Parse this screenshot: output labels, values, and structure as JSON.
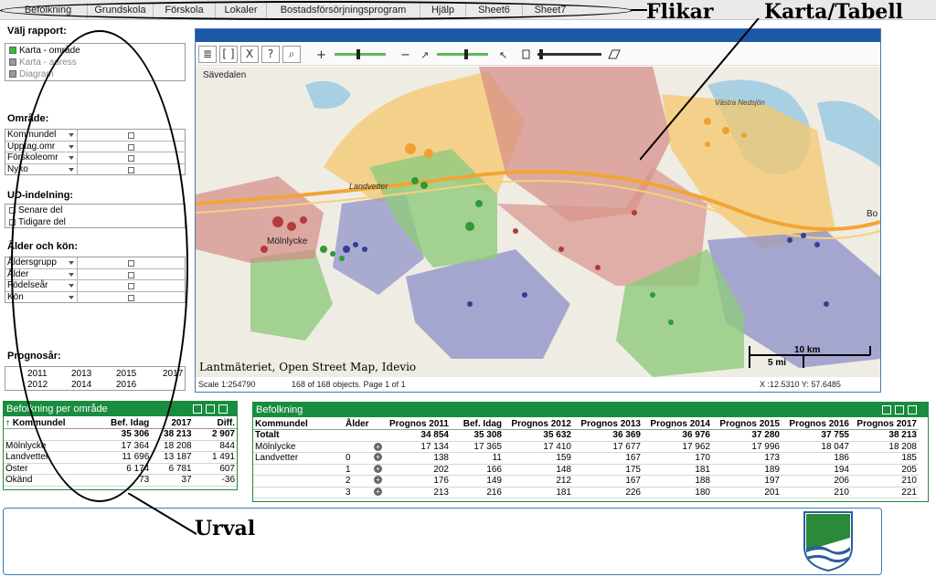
{
  "tabs": [
    "Befolkning",
    "Grundskola",
    "Förskola",
    "Lokaler",
    "Bostadsförsörjningsprogram",
    "Hjälp",
    "Sheet6",
    "Sheet7"
  ],
  "annotations": {
    "tabs": "Flikar",
    "map": "Karta/Tabell",
    "selection": "Urval"
  },
  "left": {
    "report_title": "Välj rapport:",
    "reports": [
      {
        "label": "Karta - område",
        "color": "#2ec52e"
      },
      {
        "label": "Karta - adress",
        "color": "#9a9a9a"
      },
      {
        "label": "Diagram",
        "color": "#9a9a9a"
      }
    ],
    "area_title": "Område:",
    "area_fields": [
      "Kommundel",
      "Upptag.omr",
      "Förskoleomr",
      "Nyko"
    ],
    "ud_title": "UD-indelning:",
    "ud_options": [
      "Senare del",
      "Tidigare del"
    ],
    "age_title": "Ålder och kön:",
    "age_fields": [
      "Åldersgrupp",
      "Ålder",
      "Födelseår",
      "Kön"
    ],
    "year_title": "Prognosår:",
    "years_row1": [
      "2011",
      "2013",
      "2015",
      "2017"
    ],
    "years_row2": [
      "2012",
      "2014",
      "2016"
    ]
  },
  "map": {
    "tool_buttons": [
      "≣",
      "[ ]",
      "X",
      "?",
      "⌕"
    ],
    "place_labels": [
      "Sävedalen",
      "Landvetter",
      "Mölnlycke",
      "Västra Nedsjön",
      "Bo"
    ],
    "scale_km": "10 km",
    "scale_mi": "5 mi",
    "attribution": "Lantmäteriet, Open Street Map, Idevio",
    "status_scale": "Scale 1:254790",
    "status_objects": "168 of 168 objects. Page 1 of 1",
    "status_coords": "X :12.5310 Y: 57.6485"
  },
  "table_left": {
    "title": "Befolkning per område",
    "columns": [
      "↑ Kommundel",
      "Bef. Idag",
      "2017",
      "Diff."
    ],
    "totals": [
      "",
      "35 306",
      "38 213",
      "2 907"
    ],
    "rows": [
      [
        "Mölnlycke",
        "17 364",
        "18 208",
        "844"
      ],
      [
        "Landvetter",
        "11 696",
        "13 187",
        "1 491"
      ],
      [
        "Öster",
        "6 174",
        "6 781",
        "607"
      ],
      [
        "Okänd",
        "73",
        "37",
        "-36"
      ]
    ]
  },
  "table_right": {
    "title": "Befolkning",
    "columns": [
      "Kommundel",
      "Ålder",
      "Prognos 2011",
      "Bef. Idag",
      "Prognos 2012",
      "Prognos 2013",
      "Prognos 2014",
      "Prognos 2015",
      "Prognos 2016",
      "Prognos 2017"
    ],
    "total_label": "Totalt",
    "totals": [
      "34 854",
      "35 308",
      "35 632",
      "36 369",
      "36 976",
      "37 280",
      "37 755",
      "38 213"
    ],
    "rows": [
      {
        "kd": "Mölnlycke",
        "age": "",
        "vals": [
          "17 134",
          "17 365",
          "17 410",
          "17 677",
          "17 962",
          "17 996",
          "18 047",
          "18 208"
        ]
      },
      {
        "kd": "Landvetter",
        "age": "0",
        "vals": [
          "138",
          "11",
          "159",
          "167",
          "170",
          "173",
          "186",
          "185"
        ]
      },
      {
        "kd": "",
        "age": "1",
        "vals": [
          "202",
          "166",
          "148",
          "175",
          "181",
          "189",
          "194",
          "205"
        ]
      },
      {
        "kd": "",
        "age": "2",
        "vals": [
          "176",
          "149",
          "212",
          "167",
          "188",
          "197",
          "206",
          "210"
        ]
      },
      {
        "kd": "",
        "age": "3",
        "vals": [
          "213",
          "216",
          "181",
          "226",
          "180",
          "201",
          "210",
          "221"
        ]
      }
    ]
  },
  "colors": {
    "tab_bg": "#e9e9e9",
    "map_titlebar": "#1c57a8",
    "table_header": "#188c3f",
    "selected_green": "#2ec52e"
  }
}
